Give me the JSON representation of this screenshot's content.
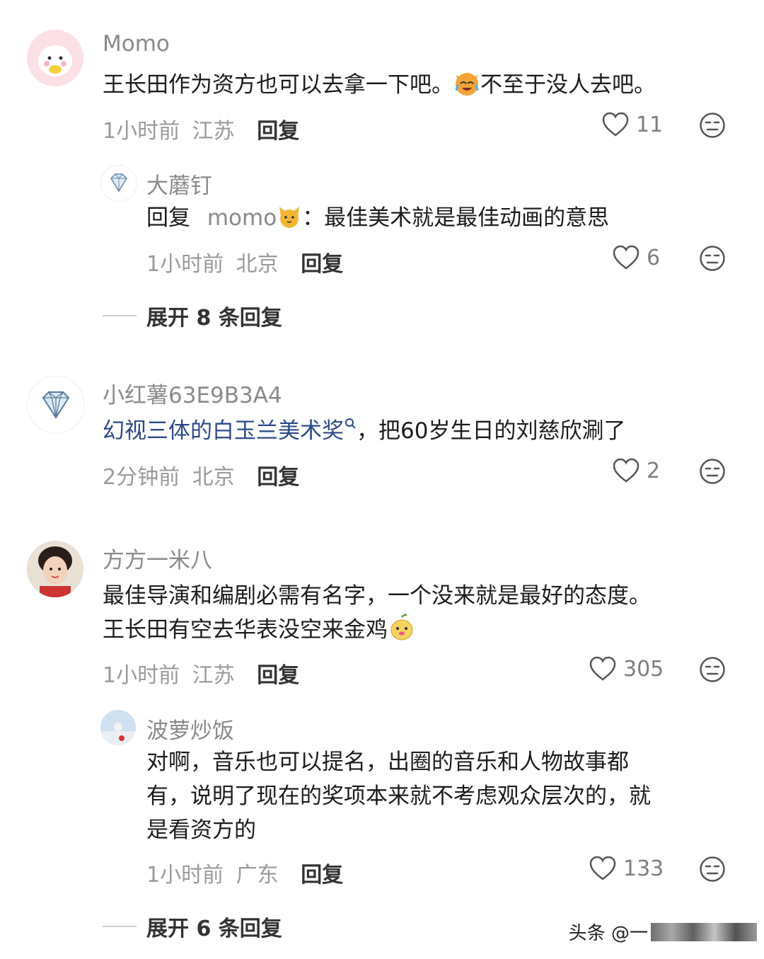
{
  "comments": [
    {
      "name": "Momo",
      "text_a": "王长田作为资方也可以去拿一下吧。",
      "text_b": "不至于没人去吧。",
      "time": "1小时前",
      "location": "江苏",
      "reply_label": "回复",
      "likes": "11",
      "replies": [
        {
          "name": "大蘑钉",
          "reply_prefix": "回复",
          "reply_to": "momo",
          "reply_text": "：最佳美术就是最佳动画的意思",
          "time": "1小时前",
          "location": "北京",
          "reply_label": "回复",
          "likes": "6"
        }
      ],
      "expand_label": "展开 8 条回复"
    },
    {
      "name": "小红薯63E9B3A4",
      "link_text": "幻视三体的白玉兰美术奖",
      "text": "，把60岁生日的刘慈欣涮了",
      "time": "2分钟前",
      "location": "北京",
      "reply_label": "回复",
      "likes": "2"
    },
    {
      "name": "方方一米八",
      "line1": "最佳导演和编剧必需有名字，一个没来就是最好的态度。",
      "line2": "王长田有空去华表没空来金鸡",
      "time": "1小时前",
      "location": "江苏",
      "reply_label": "回复",
      "likes": "305",
      "replies": [
        {
          "name": "波萝炒饭",
          "line1": "对啊，音乐也可以提名，出圈的音乐和人物故事都",
          "line2": "有，说明了现在的奖项本来就不考虑观众层次的，就",
          "line3": "是看资方的",
          "time": "1小时前",
          "location": "广东",
          "reply_label": "回复",
          "likes": "133"
        }
      ],
      "expand_label": "展开 6 条回复"
    }
  ],
  "watermark": "头条 @一"
}
